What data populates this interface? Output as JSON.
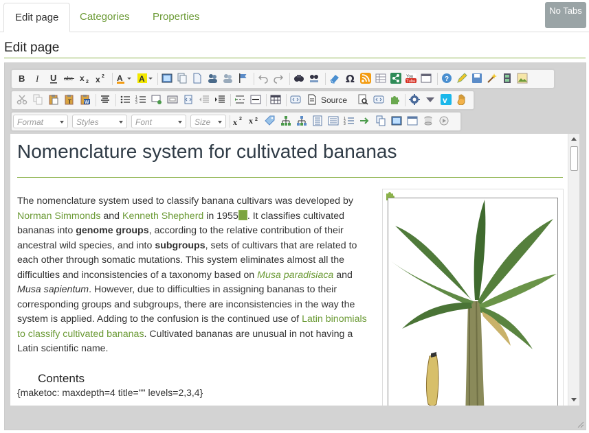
{
  "tabs": [
    {
      "label": "Edit page"
    },
    {
      "label": "Categories"
    },
    {
      "label": "Properties"
    }
  ],
  "no_tabs_label": "No Tabs",
  "page_title": "Edit page",
  "toolbar": {
    "source_label": "Source",
    "format_placeholder": "Format",
    "styles_placeholder": "Styles",
    "font_placeholder": "Font",
    "size_placeholder": "Size"
  },
  "document": {
    "heading": "Nomenclature system for cultivated bananas",
    "p_seg1": "The nomenclature system used to classify banana cultivars was developed by ",
    "link_simmonds": "Norman Simmonds",
    "p_seg2": " and ",
    "link_shepherd": "Kenneth Shepherd",
    "p_seg3": " in 1955",
    "p_seg4": ". It classifies cultivated bananas into ",
    "b_genome": "genome groups",
    "p_seg5": ", according to the relative contribution of their ancestral wild species, and into ",
    "b_subgroups": "subgroups",
    "p_seg6": ", sets of cultivars that are related to each other through somatic mutations. This system eliminates almost all the difficulties and inconsistencies of a taxonomy based on ",
    "link_paradisiaca": "Musa paradisiaca",
    "p_seg7": " and ",
    "i_sapientum": "Musa sapientum",
    "p_seg8": ". However, due to difficulties in assigning bananas to their corresponding groups and subgroups, there are inconsistencies in the way the system is applied. Adding to the confusion is the continued use of ",
    "link_latin": "Latin binomials to classify cultivated bananas",
    "p_seg9": ". Cultivated bananas are unusual in not having a Latin scientific name.",
    "contents_heading": "Contents",
    "maketoc": "{maketoc: maxdepth=4 title=\"\" levels=2,3,4}"
  },
  "colors": {
    "accent_green": "#6b9a35",
    "rule_green": "#8bb24a",
    "no_tabs_bg": "#9aa4a6"
  }
}
